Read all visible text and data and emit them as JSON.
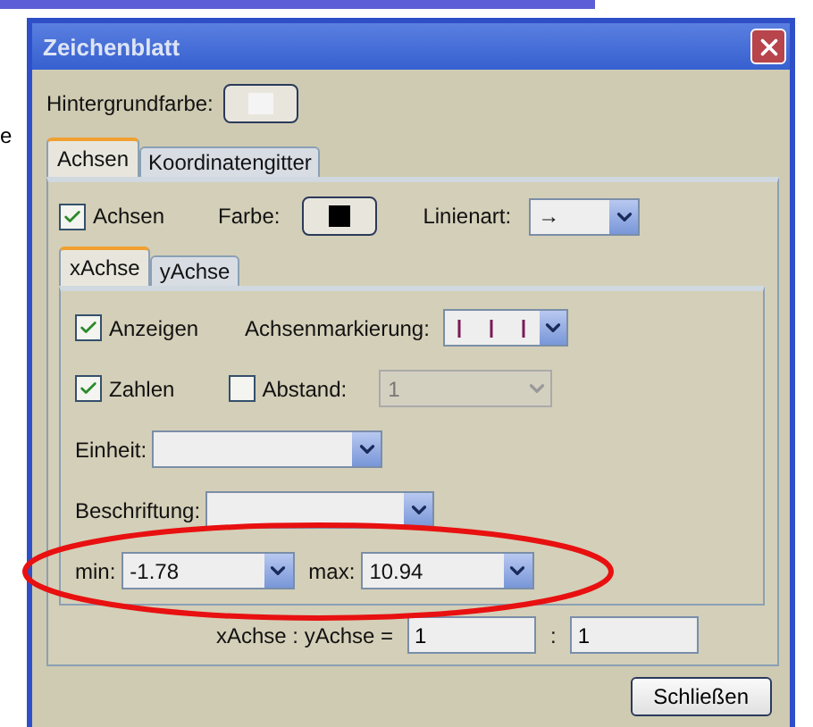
{
  "background_fragment": "e",
  "window": {
    "title": "Zeichenblatt"
  },
  "background_color": {
    "label": "Hintergrundfarbe:"
  },
  "tabs": [
    {
      "label": "Achsen",
      "selected": true
    },
    {
      "label": "Koordinatengitter",
      "selected": false
    }
  ],
  "axes": {
    "checkbox": {
      "label": "Achsen",
      "checked": true
    },
    "color_label": "Farbe:",
    "line_style": {
      "label": "Linienart:",
      "value": "→"
    }
  },
  "axis_tabs": [
    {
      "label": "xAchse",
      "selected": true
    },
    {
      "label": "yAchse",
      "selected": false
    }
  ],
  "show": {
    "label": "Anzeigen",
    "checked": true
  },
  "tick_style": {
    "label": "Achsenmarkierung:"
  },
  "numbers": {
    "label": "Zahlen",
    "checked": true
  },
  "distance": {
    "label": "Abstand:",
    "checked": false,
    "value": "1",
    "disabled": true
  },
  "unit": {
    "label": "Einheit:"
  },
  "caption": {
    "label": "Beschriftung:"
  },
  "min": {
    "label": "min:",
    "value": "-1.78"
  },
  "max": {
    "label": "max:",
    "value": "10.94"
  },
  "ratio": {
    "label": "xAchse : yAchse =",
    "x_value": "1",
    "separator": ":",
    "y_value": "1"
  },
  "buttons": [
    {
      "label": "Schließen"
    }
  ]
}
